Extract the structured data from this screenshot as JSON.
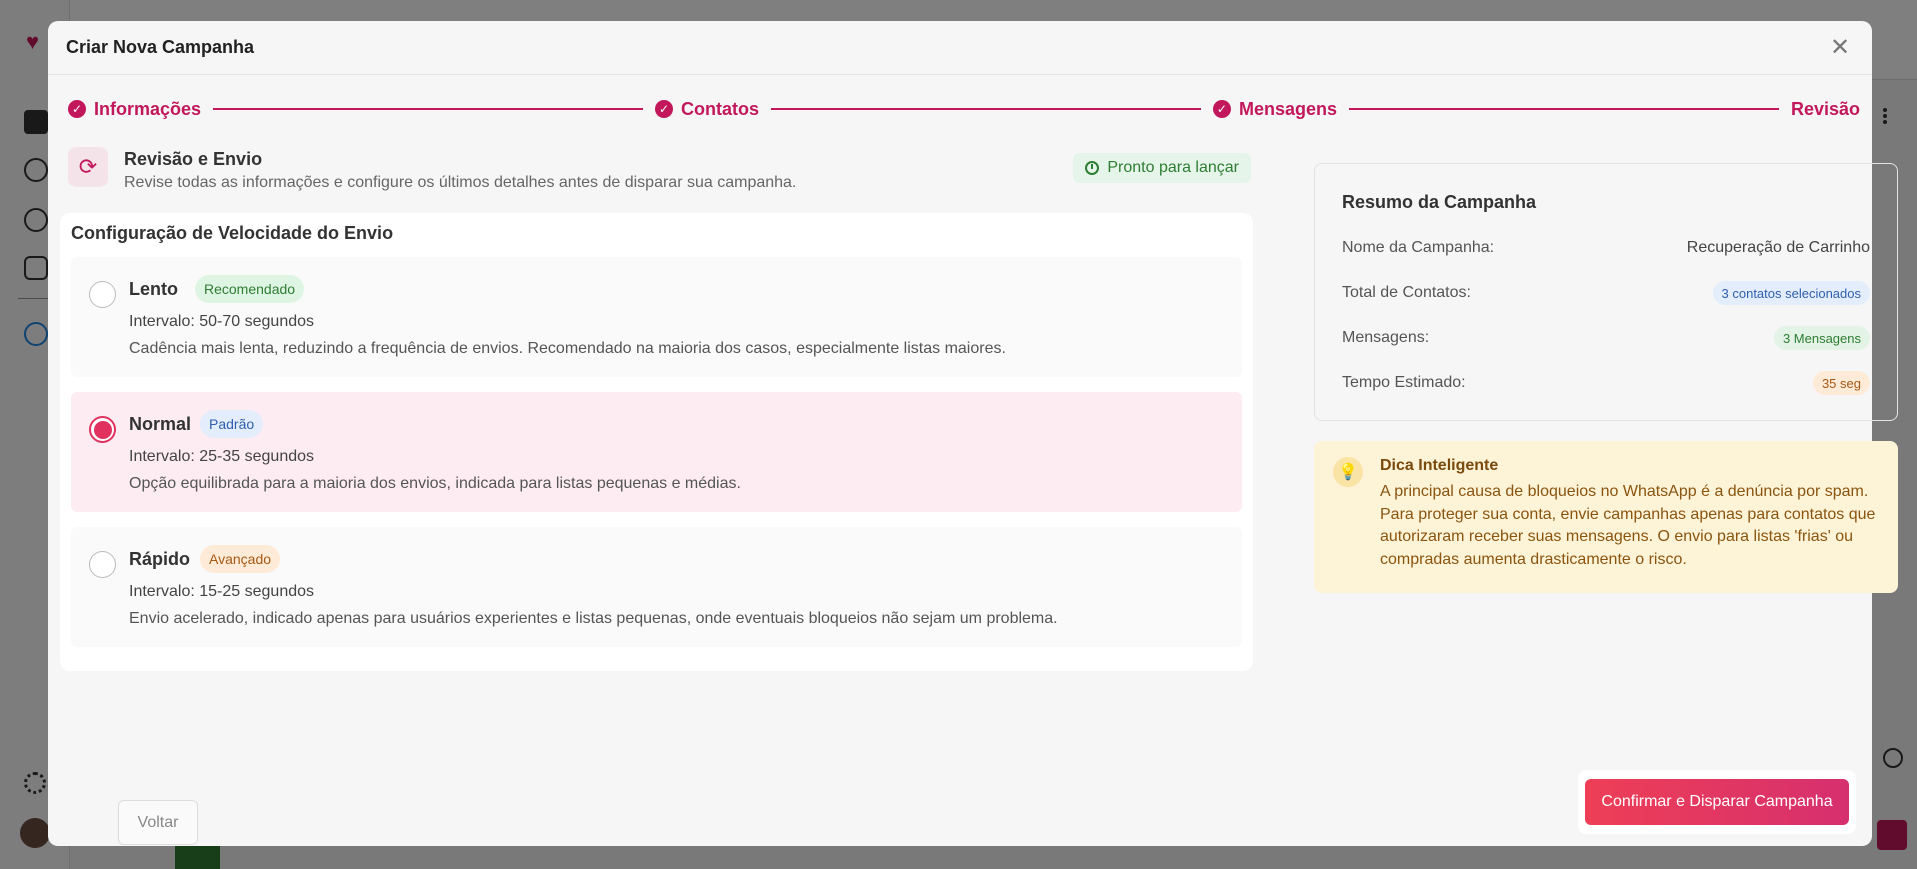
{
  "modal": {
    "title": "Criar Nova Campanha",
    "close_icon": "close-icon"
  },
  "stepper": {
    "steps": [
      {
        "label": "Informações",
        "done": true
      },
      {
        "label": "Contatos",
        "done": true
      },
      {
        "label": "Mensagens",
        "done": true
      },
      {
        "label": "Revisão",
        "done": false
      }
    ],
    "accent": "#c2185b"
  },
  "review": {
    "title": "Revisão e Envio",
    "subtitle": "Revise todas as informações e configure os últimos detalhes antes de disparar sua campanha.",
    "status": "Pronto para lançar"
  },
  "speed": {
    "title": "Configuração de Velocidade do Envio",
    "selected": "Normal",
    "options": [
      {
        "name": "Lento",
        "badge": "Recomendado",
        "interval": "Intervalo: 50-70 segundos",
        "description": "Cadência mais lenta, reduzindo a frequência de envios. Recomendado na maioria dos casos, especialmente listas maiores."
      },
      {
        "name": "Normal",
        "badge": "Padrão",
        "interval": "Intervalo: 25-35 segundos",
        "description": "Opção equilibrada para a maioria dos envios, indicada para listas pequenas e médias."
      },
      {
        "name": "Rápido",
        "badge": "Avançado",
        "interval": "Intervalo: 15-25 segundos",
        "description": "Envio acelerado, indicado apenas para usuários experientes e listas pequenas, onde eventuais bloqueios não sejam um problema."
      }
    ]
  },
  "summary": {
    "title": "Resumo da Campanha",
    "rows": [
      {
        "label": "Nome da Campanha:",
        "value": "Recuperação de Carrinho"
      },
      {
        "label": "Total de Contatos:",
        "value": "3 contatos selecionados"
      },
      {
        "label": "Mensagens:",
        "value": "3 Mensagens"
      },
      {
        "label": "Tempo Estimado:",
        "value": "35 seg"
      }
    ]
  },
  "tip": {
    "title": "Dica Inteligente",
    "text": "A principal causa de bloqueios no WhatsApp é a denúncia por spam. Para proteger sua conta, envie campanhas apenas para contatos que autorizaram receber suas mensagens. O envio para listas 'frias' ou compradas aumenta drasticamente o risco."
  },
  "footer": {
    "back_label": "Voltar",
    "confirm_label": "Confirmar e Disparar Campanha"
  }
}
